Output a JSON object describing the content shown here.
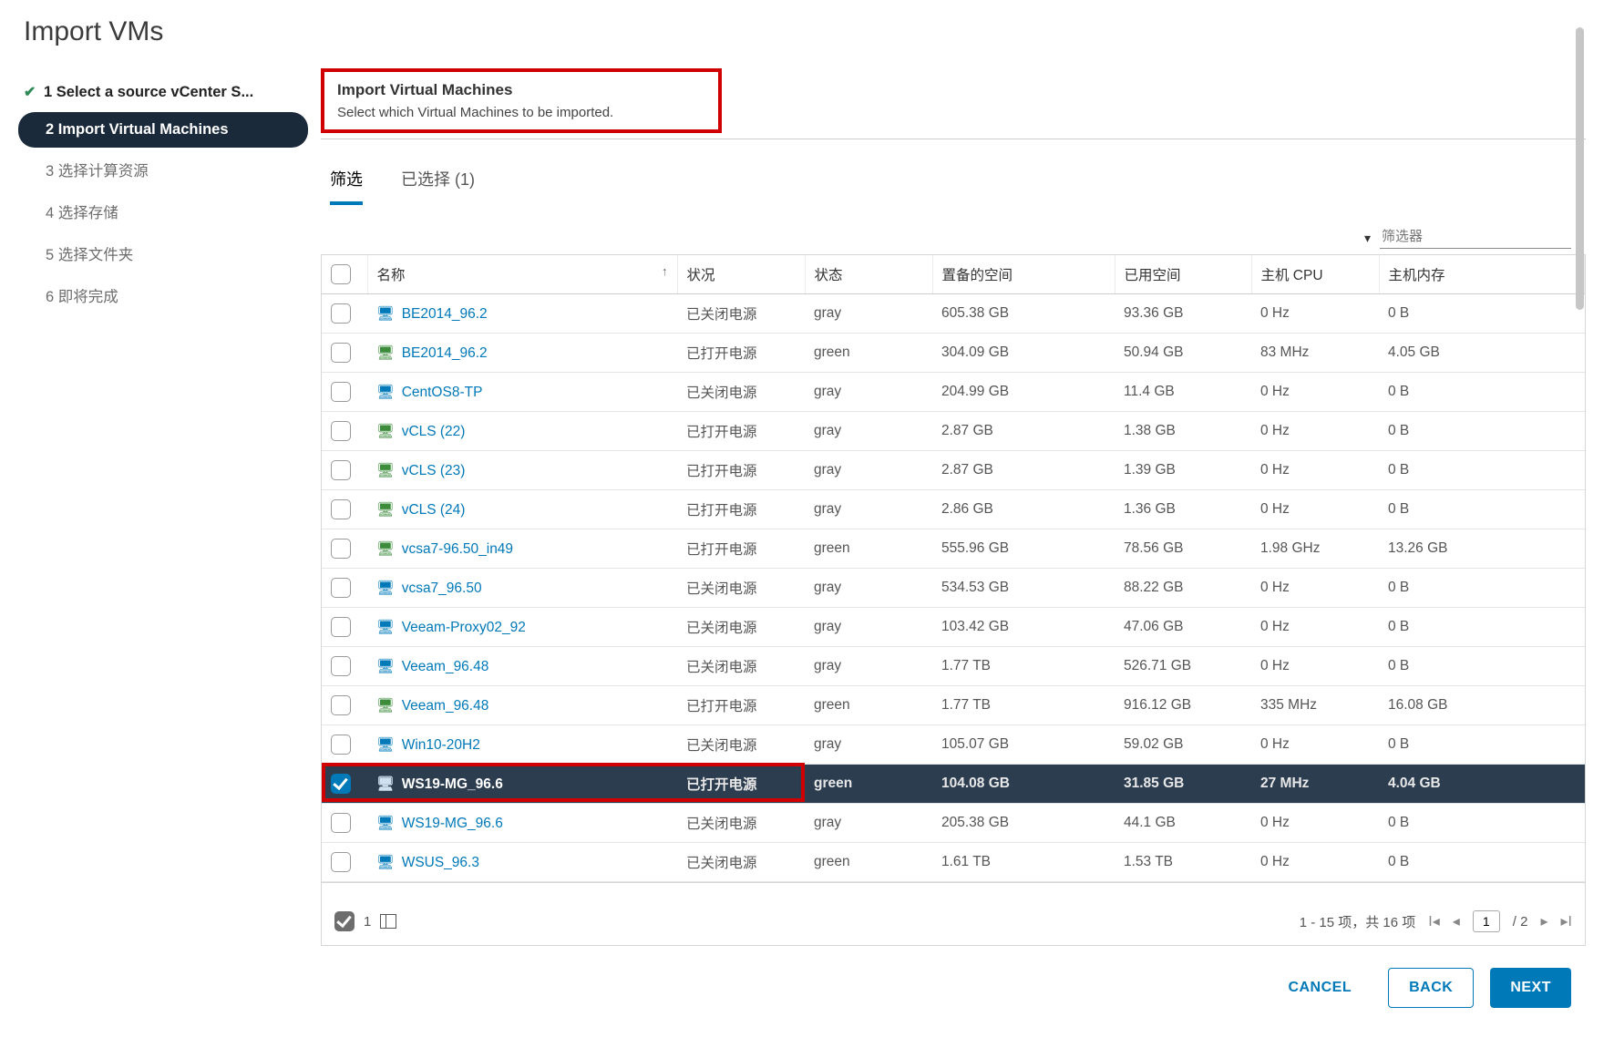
{
  "modal_title": "Import VMs",
  "steps": [
    {
      "label": "1 Select a source vCenter S...",
      "state": "done"
    },
    {
      "label": "2 Import Virtual Machines",
      "state": "active"
    },
    {
      "label": "3 选择计算资源",
      "state": "pending"
    },
    {
      "label": "4 选择存储",
      "state": "pending"
    },
    {
      "label": "5 选择文件夹",
      "state": "pending"
    },
    {
      "label": "6 即将完成",
      "state": "pending"
    }
  ],
  "section": {
    "title": "Import Virtual Machines",
    "subtitle": "Select which Virtual Machines to be imported."
  },
  "tabs": {
    "filter": "筛选",
    "selected": "已选择 (1)"
  },
  "filter": {
    "placeholder": "筛选器"
  },
  "columns": {
    "name": "名称",
    "power": "状况",
    "state": "状态",
    "provisioned": "置备的空间",
    "used": "已用空间",
    "cpu": "主机 CPU",
    "mem": "主机内存"
  },
  "rows": [
    {
      "name": "BE2014_96.2",
      "power": "已关闭电源",
      "power_on": false,
      "state": "gray",
      "prov": "605.38 GB",
      "used": "93.36 GB",
      "cpu": "0 Hz",
      "mem": "0 B",
      "checked": false
    },
    {
      "name": "BE2014_96.2",
      "power": "已打开电源",
      "power_on": true,
      "state": "green",
      "prov": "304.09 GB",
      "used": "50.94 GB",
      "cpu": "83 MHz",
      "mem": "4.05 GB",
      "checked": false
    },
    {
      "name": "CentOS8-TP",
      "power": "已关闭电源",
      "power_on": false,
      "state": "gray",
      "prov": "204.99 GB",
      "used": "11.4 GB",
      "cpu": "0 Hz",
      "mem": "0 B",
      "checked": false
    },
    {
      "name": "vCLS (22)",
      "power": "已打开电源",
      "power_on": true,
      "state": "gray",
      "prov": "2.87 GB",
      "used": "1.38 GB",
      "cpu": "0 Hz",
      "mem": "0 B",
      "checked": false
    },
    {
      "name": "vCLS (23)",
      "power": "已打开电源",
      "power_on": true,
      "state": "gray",
      "prov": "2.87 GB",
      "used": "1.39 GB",
      "cpu": "0 Hz",
      "mem": "0 B",
      "checked": false
    },
    {
      "name": "vCLS (24)",
      "power": "已打开电源",
      "power_on": true,
      "state": "gray",
      "prov": "2.86 GB",
      "used": "1.36 GB",
      "cpu": "0 Hz",
      "mem": "0 B",
      "checked": false
    },
    {
      "name": "vcsa7-96.50_in49",
      "power": "已打开电源",
      "power_on": true,
      "state": "green",
      "prov": "555.96 GB",
      "used": "78.56 GB",
      "cpu": "1.98 GHz",
      "mem": "13.26 GB",
      "checked": false
    },
    {
      "name": "vcsa7_96.50",
      "power": "已关闭电源",
      "power_on": false,
      "state": "gray",
      "prov": "534.53 GB",
      "used": "88.22 GB",
      "cpu": "0 Hz",
      "mem": "0 B",
      "checked": false
    },
    {
      "name": "Veeam-Proxy02_92",
      "power": "已关闭电源",
      "power_on": false,
      "state": "gray",
      "prov": "103.42 GB",
      "used": "47.06 GB",
      "cpu": "0 Hz",
      "mem": "0 B",
      "checked": false
    },
    {
      "name": "Veeam_96.48",
      "power": "已关闭电源",
      "power_on": false,
      "state": "gray",
      "prov": "1.77 TB",
      "used": "526.71 GB",
      "cpu": "0 Hz",
      "mem": "0 B",
      "checked": false
    },
    {
      "name": "Veeam_96.48",
      "power": "已打开电源",
      "power_on": true,
      "state": "green",
      "prov": "1.77 TB",
      "used": "916.12 GB",
      "cpu": "335 MHz",
      "mem": "16.08 GB",
      "checked": false
    },
    {
      "name": "Win10-20H2",
      "power": "已关闭电源",
      "power_on": false,
      "state": "gray",
      "prov": "105.07 GB",
      "used": "59.02 GB",
      "cpu": "0 Hz",
      "mem": "0 B",
      "checked": false
    },
    {
      "name": "WS19-MG_96.6",
      "power": "已打开电源",
      "power_on": true,
      "state": "green",
      "prov": "104.08 GB",
      "used": "31.85 GB",
      "cpu": "27 MHz",
      "mem": "4.04 GB",
      "checked": true
    },
    {
      "name": "WS19-MG_96.6",
      "power": "已关闭电源",
      "power_on": false,
      "state": "gray",
      "prov": "205.38 GB",
      "used": "44.1 GB",
      "cpu": "0 Hz",
      "mem": "0 B",
      "checked": false
    },
    {
      "name": "WSUS_96.3",
      "power": "已关闭电源",
      "power_on": false,
      "state": "green",
      "prov": "1.61 TB",
      "used": "1.53 TB",
      "cpu": "0 Hz",
      "mem": "0 B",
      "checked": false
    }
  ],
  "pager": {
    "selected_count": "1",
    "range": "1 - 15 项，共 16 项",
    "page": "1",
    "total_pages": "/ 2"
  },
  "actions": {
    "cancel": "CANCEL",
    "back": "BACK",
    "next": "NEXT"
  }
}
